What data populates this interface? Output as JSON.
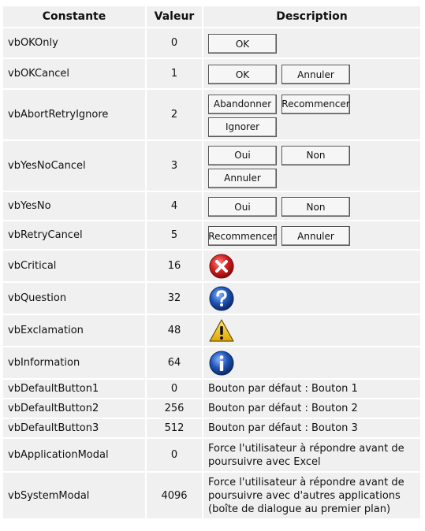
{
  "header": {
    "col1": "Constante",
    "col2": "Valeur",
    "col3": "Description"
  },
  "buttons_rows": [
    {
      "name": "vbOKOnly",
      "value": "0",
      "buttons": [
        "OK"
      ]
    },
    {
      "name": "vbOKCancel",
      "value": "1",
      "buttons": [
        "OK",
        "Annuler"
      ]
    },
    {
      "name": "vbAbortRetryIgnore",
      "value": "2",
      "buttons": [
        "Abandonner",
        "Recommencer",
        "Ignorer"
      ]
    },
    {
      "name": "vbYesNoCancel",
      "value": "3",
      "buttons": [
        "Oui",
        "Non",
        "Annuler"
      ]
    },
    {
      "name": "vbYesNo",
      "value": "4",
      "buttons": [
        "Oui",
        "Non"
      ]
    },
    {
      "name": "vbRetryCancel",
      "value": "5",
      "buttons": [
        "Recommencer",
        "Annuler"
      ]
    }
  ],
  "icon_rows": [
    {
      "name": "vbCritical",
      "value": "16",
      "icon": "critical-icon"
    },
    {
      "name": "vbQuestion",
      "value": "32",
      "icon": "question-icon"
    },
    {
      "name": "vbExclamation",
      "value": "48",
      "icon": "exclamation-icon"
    },
    {
      "name": "vbInformation",
      "value": "64",
      "icon": "information-icon"
    }
  ],
  "default_rows": [
    {
      "name": "vbDefaultButton1",
      "value": "0",
      "desc": "Bouton par défaut : Bouton 1"
    },
    {
      "name": "vbDefaultButton2",
      "value": "256",
      "desc": "Bouton par défaut : Bouton 2"
    },
    {
      "name": "vbDefaultButton3",
      "value": "512",
      "desc": "Bouton par défaut : Bouton 3"
    }
  ],
  "modal_rows": [
    {
      "name": "vbApplicationModal",
      "value": "0",
      "desc": "Force l'utilisateur à répondre avant de poursuivre avec Excel"
    },
    {
      "name": "vbSystemModal",
      "value": "4096",
      "desc": "Force l'utilisateur à répondre avant de poursuivre avec d'autres applications (boîte de dialogue au premier plan)"
    }
  ],
  "colors": {
    "cell_bg": "#f0f0f0",
    "critical": "#d42020",
    "question": "#1f56b8",
    "exclamation": "#f2c200",
    "information": "#1f56b8"
  }
}
